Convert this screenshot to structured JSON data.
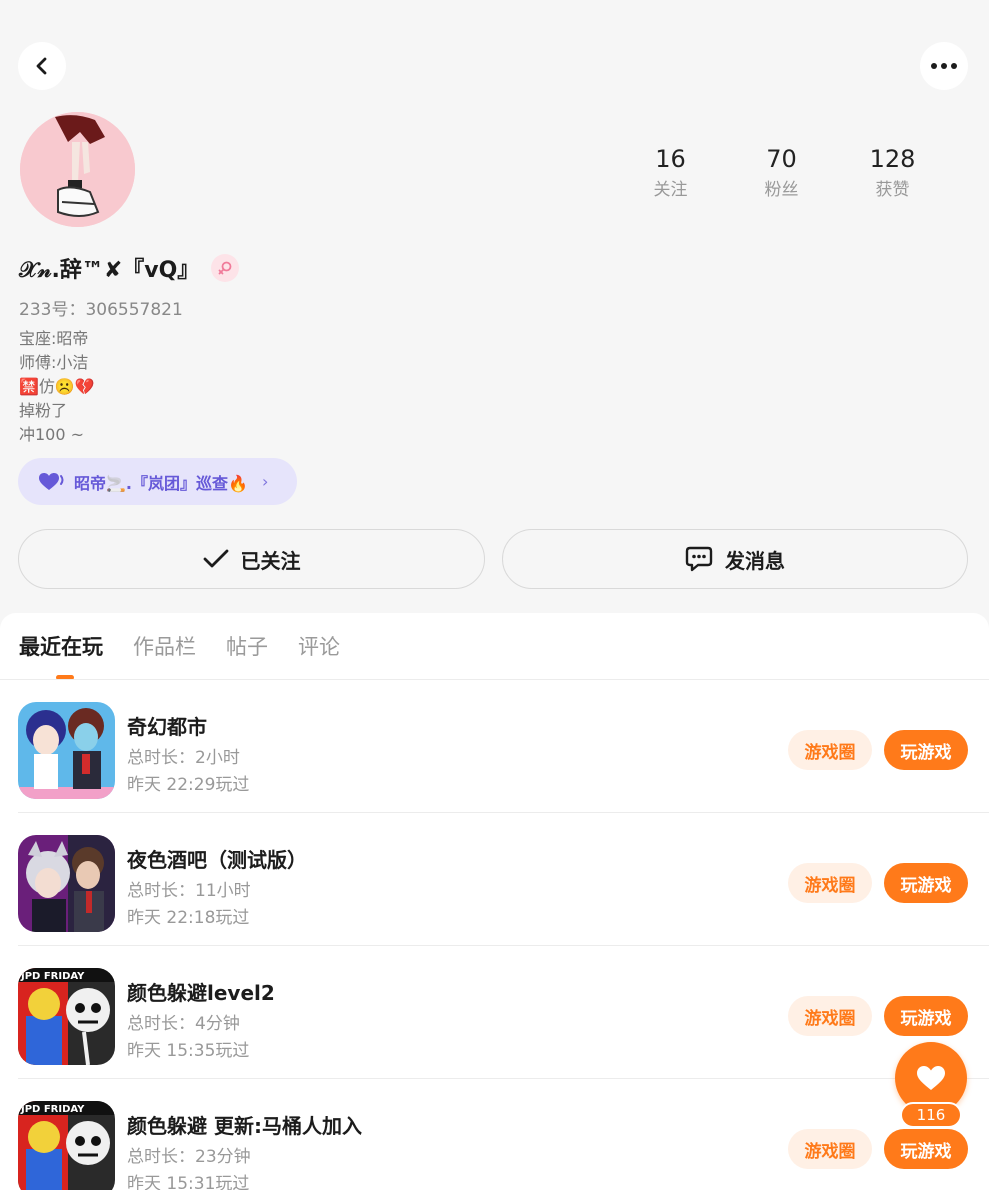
{
  "nav": {
    "back_icon": "chevron-left-icon",
    "more_icon": "more-dots-icon"
  },
  "stats": [
    {
      "value": "16",
      "label": "关注"
    },
    {
      "value": "70",
      "label": "粉丝"
    },
    {
      "value": "128",
      "label": "获赞"
    }
  ],
  "profile": {
    "nickname": "𝒳𝓃.辞™✘『vQ』",
    "gender_icon": "female-icon",
    "uid": "233号：306557821",
    "bio": [
      "宝座:昭帝",
      "师傅:小洁",
      "🈲仿☹️💔",
      "掉粉了",
      "冲100 ~"
    ]
  },
  "guild": {
    "label": "昭帝🚬.『岚团』巡查🔥",
    "icon": "heart-icon"
  },
  "actions": {
    "follow_label": "已关注",
    "message_label": "发消息"
  },
  "tabs": [
    "最近在玩",
    "作品栏",
    "帖子",
    "评论"
  ],
  "games": [
    {
      "title": "奇幻都市",
      "duration": "总时长：2小时",
      "last_played": "昨天 22:29玩过"
    },
    {
      "title": "夜色酒吧（测试版）",
      "duration": "总时长：11小时",
      "last_played": "昨天 22:18玩过"
    },
    {
      "title": "颜色躲避level2",
      "duration": "总时长：4分钟",
      "last_played": "昨天 15:35玩过"
    },
    {
      "title": "颜色躲避 更新:马桶人加入",
      "duration": "总时长：23分钟",
      "last_played": "昨天 15:31玩过"
    }
  ],
  "game_buttons": {
    "circle": "游戏圈",
    "play": "玩游戏"
  },
  "game_icon_badge": "JPD FRIDAY",
  "like": {
    "count": "116",
    "icon": "heart-icon"
  },
  "colors": {
    "accent": "#ff7a1a",
    "guild_bg": "#e6e4fb",
    "guild_text": "#6659d8"
  }
}
